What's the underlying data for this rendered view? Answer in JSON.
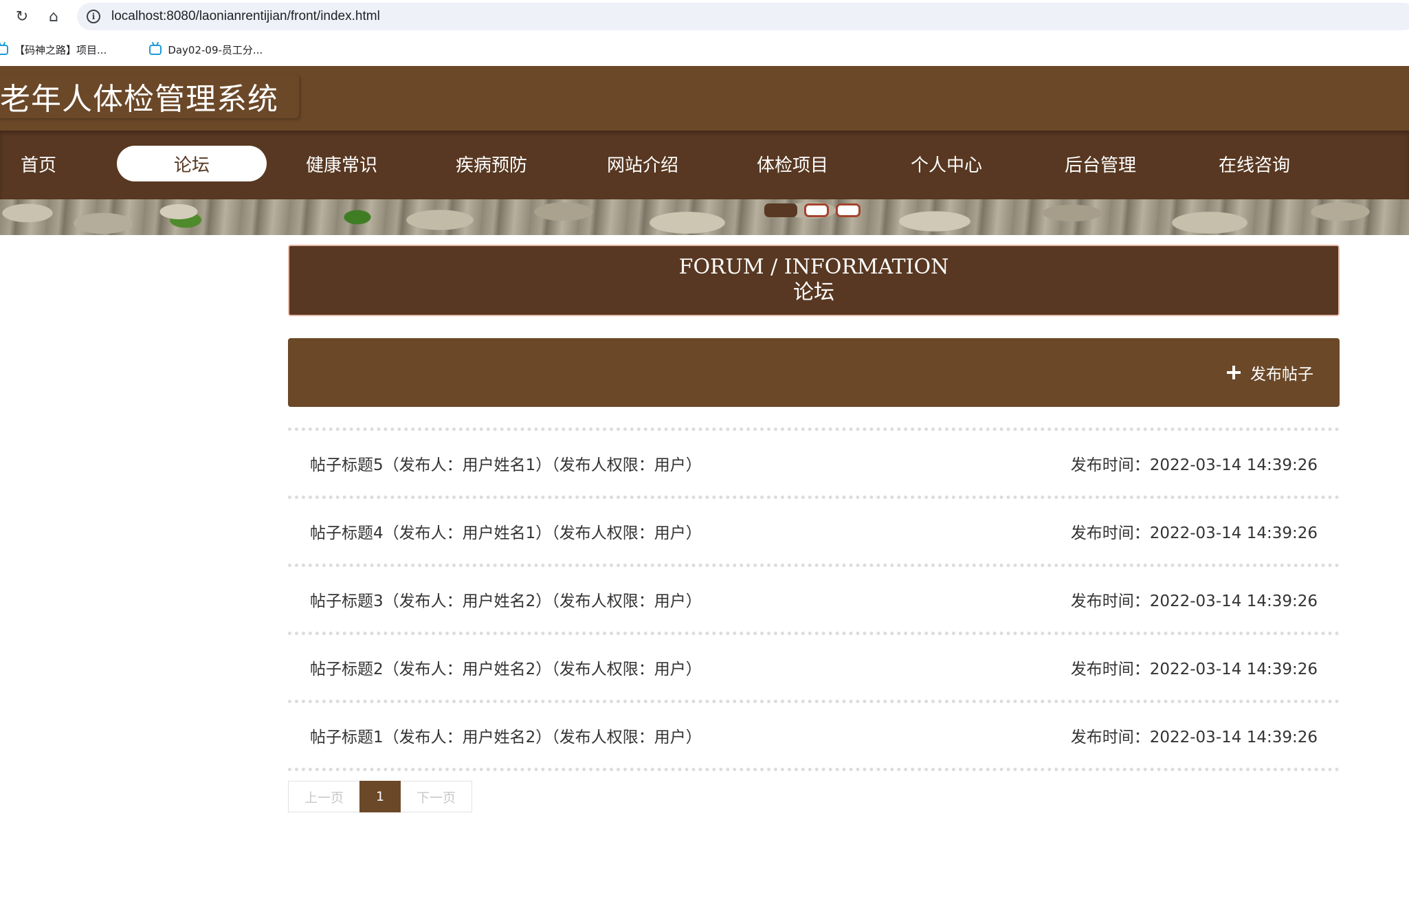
{
  "browser": {
    "url": "localhost:8080/laonianrentijian/front/index.html",
    "bookmarks": [
      "【码神之路】项目...",
      "Day02-09-员工分..."
    ]
  },
  "site": {
    "title": "老年人体检管理系统"
  },
  "nav": {
    "items": [
      "首页",
      "论坛",
      "健康常识",
      "疾病预防",
      "网站介绍",
      "体检项目",
      "个人中心",
      "后台管理",
      "在线咨询"
    ],
    "active": "论坛"
  },
  "carousel": {
    "slide_count": 3,
    "active_index": 0
  },
  "section": {
    "title_en": "FORUM / INFORMATION",
    "title_cn": "论坛"
  },
  "actions": {
    "publish_label": "发布帖子"
  },
  "posts": [
    {
      "title": "帖子标题5（发布人：用户姓名1）（发布人权限：用户）",
      "time": "发布时间：2022-03-14 14:39:26"
    },
    {
      "title": "帖子标题4（发布人：用户姓名1）（发布人权限：用户）",
      "time": "发布时间：2022-03-14 14:39:26"
    },
    {
      "title": "帖子标题3（发布人：用户姓名2）（发布人权限：用户）",
      "time": "发布时间：2022-03-14 14:39:26"
    },
    {
      "title": "帖子标题2（发布人：用户姓名2）（发布人权限：用户）",
      "time": "发布时间：2022-03-14 14:39:26"
    },
    {
      "title": "帖子标题1（发布人：用户姓名2）（发布人权限：用户）",
      "time": "发布时间：2022-03-14 14:39:26"
    }
  ],
  "pagination": {
    "prev_label": "上一页",
    "current_page": "1",
    "next_label": "下一页"
  }
}
